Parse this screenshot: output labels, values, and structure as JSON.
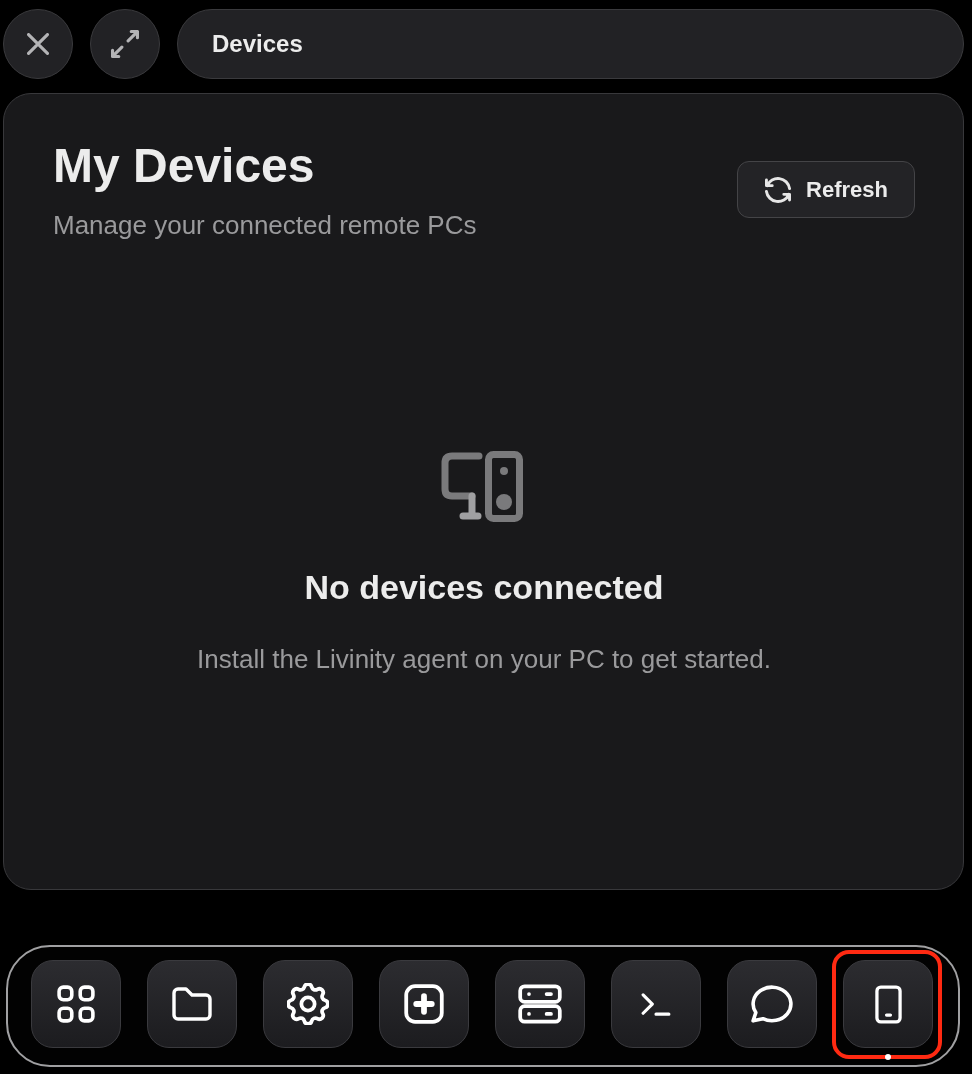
{
  "window": {
    "title": "Devices",
    "controls": [
      {
        "kind": "close"
      },
      {
        "kind": "expand"
      }
    ]
  },
  "page": {
    "title": "My Devices",
    "subtitle": "Manage your connected remote PCs",
    "refresh_button": {
      "label": "Refresh"
    }
  },
  "empty_state": {
    "title": "No devices connected",
    "message": "Install the Livinity agent on your PC to get started."
  },
  "dock": {
    "items": [
      {
        "kind": "grid",
        "open": false,
        "highlighted": false
      },
      {
        "kind": "folder",
        "open": false,
        "highlighted": false
      },
      {
        "kind": "settings",
        "open": false,
        "highlighted": false
      },
      {
        "kind": "plus",
        "open": false,
        "highlighted": false
      },
      {
        "kind": "server",
        "open": false,
        "highlighted": false
      },
      {
        "kind": "terminal",
        "open": false,
        "highlighted": false
      },
      {
        "kind": "chat",
        "open": false,
        "highlighted": false
      },
      {
        "kind": "phone",
        "open": true,
        "highlighted": true
      }
    ]
  }
}
